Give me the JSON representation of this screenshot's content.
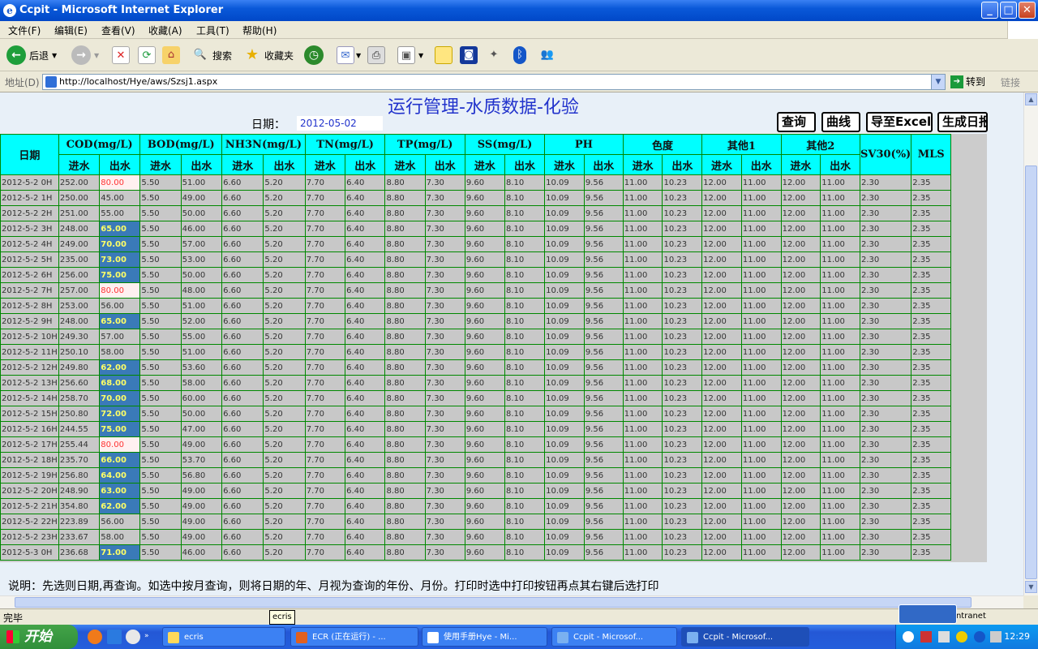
{
  "window": {
    "title": "Ccpit - Microsoft Internet Explorer",
    "btn_min": "_",
    "btn_max": "□",
    "btn_close": "✕"
  },
  "menu": [
    "文件(F)",
    "编辑(E)",
    "查看(V)",
    "收藏(A)",
    "工具(T)",
    "帮助(H)"
  ],
  "toolbar": {
    "back": "后退",
    "search": "搜索",
    "favorites": "收藏夹"
  },
  "address": {
    "label": "地址(D)",
    "url": "http://localhost/Hye/aws/Szsj1.aspx",
    "go": "转到",
    "links": "链接"
  },
  "page": {
    "title": "运行管理-水质数据-化验",
    "date_label": "日期：",
    "date_value": "2012-05-02",
    "buttons": {
      "query": "查询",
      "curve": "曲线",
      "export": "导至Excel",
      "report": "生成日报"
    },
    "note": "说明：先选则日期,再查询。如选中按月查询，则将日期的年、月视为查询的年份、月份。打印时选中打印按钮再点其右键后选打印"
  },
  "table": {
    "date_header": "日期",
    "groups": [
      "COD(mg/L)",
      "BOD(mg/L)",
      "NH3N(mg/L)",
      "TN(mg/L)",
      "TP(mg/L)",
      "SS(mg/L)",
      "PH",
      "色度",
      "其他1",
      "其他2"
    ],
    "sub_in": "进水",
    "sub_out": "出水",
    "sv30": "SV30(%)",
    "mls": "MLS",
    "rows": [
      {
        "date": "2012-5-2 0H",
        "cod_in": "252.00",
        "cod_out": "80.00",
        "flag": "high",
        "bod_out": "51.00"
      },
      {
        "date": "2012-5-2 1H",
        "cod_in": "250.00",
        "cod_out": "45.00",
        "flag": "",
        "bod_out": "49.00"
      },
      {
        "date": "2012-5-2 2H",
        "cod_in": "251.00",
        "cod_out": "55.00",
        "flag": "",
        "bod_out": "50.00"
      },
      {
        "date": "2012-5-2 3H",
        "cod_in": "248.00",
        "cod_out": "65.00",
        "flag": "mark",
        "bod_out": "46.00"
      },
      {
        "date": "2012-5-2 4H",
        "cod_in": "249.00",
        "cod_out": "70.00",
        "flag": "mark",
        "bod_out": "57.00"
      },
      {
        "date": "2012-5-2 5H",
        "cod_in": "235.00",
        "cod_out": "73.00",
        "flag": "mark",
        "bod_out": "53.00"
      },
      {
        "date": "2012-5-2 6H",
        "cod_in": "256.00",
        "cod_out": "75.00",
        "flag": "mark",
        "bod_out": "50.00"
      },
      {
        "date": "2012-5-2 7H",
        "cod_in": "257.00",
        "cod_out": "80.00",
        "flag": "high",
        "bod_out": "48.00"
      },
      {
        "date": "2012-5-2 8H",
        "cod_in": "253.00",
        "cod_out": "56.00",
        "flag": "",
        "bod_out": "51.00"
      },
      {
        "date": "2012-5-2 9H",
        "cod_in": "248.00",
        "cod_out": "65.00",
        "flag": "mark",
        "bod_out": "52.00"
      },
      {
        "date": "2012-5-2 10H",
        "cod_in": "249.30",
        "cod_out": "57.00",
        "flag": "",
        "bod_out": "55.00"
      },
      {
        "date": "2012-5-2 11H",
        "cod_in": "250.10",
        "cod_out": "58.00",
        "flag": "",
        "bod_out": "51.00"
      },
      {
        "date": "2012-5-2 12H",
        "cod_in": "249.80",
        "cod_out": "62.00",
        "flag": "mark",
        "bod_out": "53.60"
      },
      {
        "date": "2012-5-2 13H",
        "cod_in": "256.60",
        "cod_out": "68.00",
        "flag": "mark",
        "bod_out": "58.00"
      },
      {
        "date": "2012-5-2 14H",
        "cod_in": "258.70",
        "cod_out": "70.00",
        "flag": "mark",
        "bod_out": "60.00"
      },
      {
        "date": "2012-5-2 15H",
        "cod_in": "250.80",
        "cod_out": "72.00",
        "flag": "mark",
        "bod_out": "50.00"
      },
      {
        "date": "2012-5-2 16H",
        "cod_in": "244.55",
        "cod_out": "75.00",
        "flag": "mark",
        "bod_out": "47.00"
      },
      {
        "date": "2012-5-2 17H",
        "cod_in": "255.44",
        "cod_out": "80.00",
        "flag": "high",
        "bod_out": "49.00"
      },
      {
        "date": "2012-5-2 18H",
        "cod_in": "235.70",
        "cod_out": "66.00",
        "flag": "mark",
        "bod_out": "53.70"
      },
      {
        "date": "2012-5-2 19H",
        "cod_in": "256.80",
        "cod_out": "64.00",
        "flag": "mark",
        "bod_out": "56.80"
      },
      {
        "date": "2012-5-2 20H",
        "cod_in": "248.90",
        "cod_out": "63.00",
        "flag": "mark",
        "bod_out": "49.00"
      },
      {
        "date": "2012-5-2 21H",
        "cod_in": "354.80",
        "cod_out": "62.00",
        "flag": "mark",
        "bod_out": "49.00"
      },
      {
        "date": "2012-5-2 22H",
        "cod_in": "223.89",
        "cod_out": "56.00",
        "flag": "",
        "bod_out": "49.00"
      },
      {
        "date": "2012-5-2 23H",
        "cod_in": "233.67",
        "cod_out": "58.00",
        "flag": "",
        "bod_out": "49.00"
      },
      {
        "date": "2012-5-3 0H",
        "cod_in": "236.68",
        "cod_out": "71.00",
        "flag": "mark",
        "bod_out": "46.00"
      }
    ],
    "constant_cells": {
      "bod_in": "5.50",
      "nh3n_in": "6.60",
      "nh3n_out": "5.20",
      "tn_in": "7.70",
      "tn_out": "6.40",
      "tp_in": "8.80",
      "tp_out": "7.30",
      "ss_in": "9.60",
      "ss_out": "8.10",
      "ph_in": "10.09",
      "ph_out": "9.56",
      "color_in": "11.00",
      "color_out": "10.23",
      "o1_in": "12.00",
      "o1_out": "11.00",
      "o2_in": "12.00",
      "o2_out": "11.00",
      "sv30": "2.30",
      "mls": "2.35"
    }
  },
  "statusbar": {
    "text": "完毕",
    "zone": "Intranet",
    "tooltip": "ecris"
  },
  "taskbar": {
    "start": "开始",
    "tasks": [
      "ecris",
      "ECR (正在运行) - ...",
      "使用手册Hye - Mi...",
      "Ccpit - Microsof...",
      "Ccpit - Microsof..."
    ],
    "clock": "12:29"
  },
  "colors": {
    "header_bg": "#00ffff",
    "cell_bg": "#c8c8c8",
    "mark_bg": "#3a7ab8",
    "high_fg": "#ff3333",
    "grid": "#008800",
    "title": "#2233cc"
  }
}
